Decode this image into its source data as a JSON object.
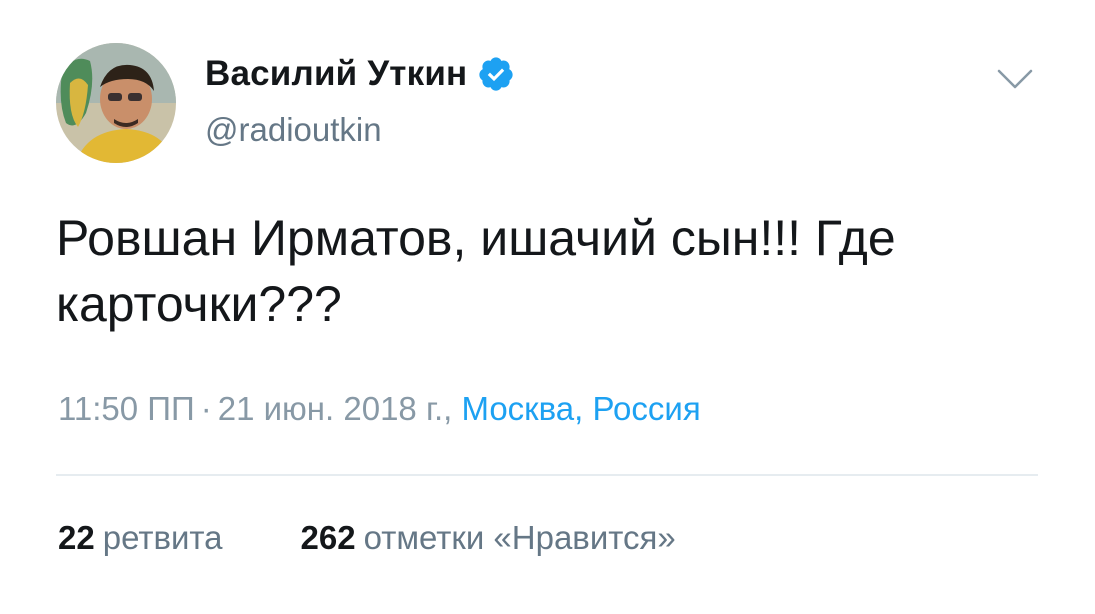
{
  "author": {
    "name": "Василий Уткин",
    "handle": "@radioutkin",
    "verified": true,
    "avatar_icon": "avatar-photo-icon",
    "verified_icon": "verified-badge-icon"
  },
  "menu": {
    "icon": "chevron-down-icon"
  },
  "tweet": {
    "text": "Ровшан Ирматов, ишачий сын!!! Где карточки???"
  },
  "meta": {
    "time": "11:50 ПП",
    "separator": "·",
    "date": "21 июн. 2018 г.,",
    "location": "Москва, Россия"
  },
  "stats": {
    "retweets_count": "22",
    "retweets_label": "ретвита",
    "likes_count": "262",
    "likes_label": "отметки «Нравится»"
  },
  "colors": {
    "accent": "#1da1f2",
    "text": "#14171a",
    "secondary": "#657786",
    "meta": "#8899a6",
    "divider": "#e6ecf0"
  }
}
